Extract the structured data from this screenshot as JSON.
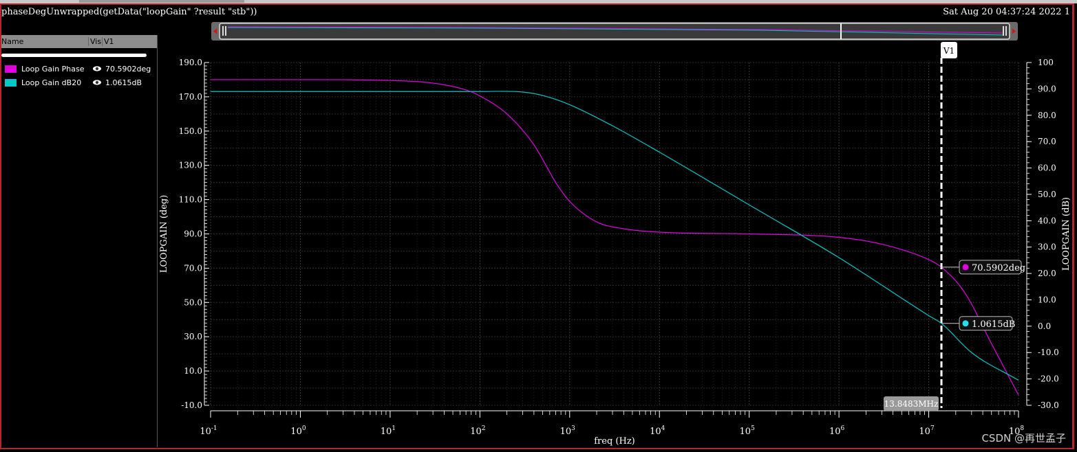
{
  "window": {
    "expression": "phaseDegUnwrapped(getData(\"loopGain\" ?result \"stb\"))",
    "datestamp": "Sat Aug 20 04:37:24 2022   1"
  },
  "legend_panel": {
    "headers": {
      "name": "Name",
      "vis": "Vis",
      "v1": "V1"
    },
    "rows": [
      {
        "label": "Loop Gain Phase",
        "value": "70.5902deg",
        "color": "#e000e0",
        "icon": "eye-icon"
      },
      {
        "label": "Loop Gain dB20",
        "value": "1.0615dB",
        "color": "#00c8c8",
        "icon": "eye-icon"
      }
    ]
  },
  "marker": {
    "name": "V1",
    "freq_label": "13.8483MHz",
    "freq_hz": 13848300,
    "phase_label": "70.5902deg",
    "gain_label": "1.0615dB"
  },
  "watermark": "CSDN @再世孟子",
  "chart_data": {
    "type": "line",
    "xlabel": "freq (Hz)",
    "ylabel_left": "LOOPGAIN (deg)",
    "ylabel_right": "LOOPGAIN (dB)",
    "x_scale": "log",
    "xlim": [
      0.1,
      100000000
    ],
    "x_ticks": [
      {
        "base": "10",
        "exp": "-1"
      },
      {
        "base": "10",
        "exp": "0"
      },
      {
        "base": "10",
        "exp": "1"
      },
      {
        "base": "10",
        "exp": "2"
      },
      {
        "base": "10",
        "exp": "3"
      },
      {
        "base": "10",
        "exp": "4"
      },
      {
        "base": "10",
        "exp": "5"
      },
      {
        "base": "10",
        "exp": "6"
      },
      {
        "base": "10",
        "exp": "7"
      },
      {
        "base": "10",
        "exp": "8"
      }
    ],
    "ylim_left": [
      -10,
      190
    ],
    "yticks_left": [
      "190.0",
      "170.0",
      "150.0",
      "130.0",
      "110.0",
      "90.0",
      "70.0",
      "50.0",
      "30.0",
      "10.0",
      "-10.0"
    ],
    "ylim_right": [
      -30,
      100
    ],
    "yticks_right": [
      "100",
      "90.0",
      "80.0",
      "70.0",
      "60.0",
      "50.0",
      "40.0",
      "30.0",
      "20.0",
      "10.0",
      "0.0",
      "-10.0",
      "-20.0",
      "-30.0"
    ],
    "grid": true,
    "background": "#000000",
    "series": [
      {
        "name": "Loop Gain Phase",
        "axis": "left",
        "color": "#e000e0",
        "x": [
          0.1,
          1,
          10,
          30,
          70,
          100,
          200,
          400,
          700,
          1000,
          2000,
          4000,
          10000,
          100000,
          1000000,
          3000000,
          10000000,
          13848300,
          25000000,
          50000000,
          100000000
        ],
        "y": [
          180,
          180,
          179.5,
          178,
          174,
          170.5,
          160,
          142,
          120,
          109,
          97,
          93,
          91,
          90,
          88,
          84,
          75,
          70.6,
          56,
          26,
          -4
        ]
      },
      {
        "name": "Loop Gain dB20",
        "axis": "right",
        "color": "#00c8c8",
        "x": [
          0.1,
          10,
          100,
          300,
          500,
          1000,
          3000,
          10000,
          100000,
          1000000,
          10000000,
          13848300,
          30000000,
          100000000
        ],
        "y": [
          89,
          89,
          89,
          88.8,
          87.5,
          84,
          76,
          66,
          46,
          26,
          4,
          1.06,
          -10,
          -20.5
        ]
      }
    ]
  }
}
